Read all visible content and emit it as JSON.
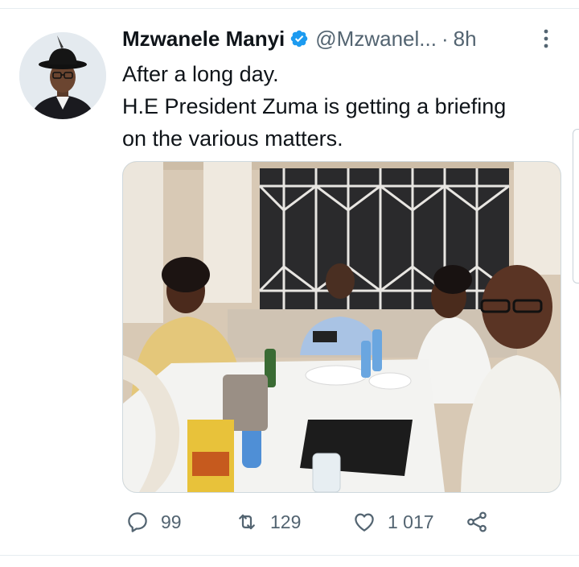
{
  "tweet": {
    "author_name": "Mzwanele Manyi",
    "handle": "@Mzwanel...",
    "separator": "·",
    "time_ago": "8h",
    "verified": true,
    "text_lines": [
      "After a long day.",
      "H.E President Zuma is getting a briefing",
      "on the various matters."
    ],
    "media": {
      "type": "photo"
    }
  },
  "actions": {
    "reply_count": "99",
    "retweet_count": "129",
    "like_count": "1 017"
  },
  "icons": {
    "verified": "verified-badge-icon",
    "more": "more-vertical-icon",
    "reply": "reply-icon",
    "retweet": "retweet-icon",
    "like": "heart-icon",
    "share": "share-icon"
  },
  "colors": {
    "verified_blue": "#1d9bf0",
    "secondary_text": "#536471",
    "primary_text": "#0f1419",
    "divider": "#e6ecf0"
  }
}
